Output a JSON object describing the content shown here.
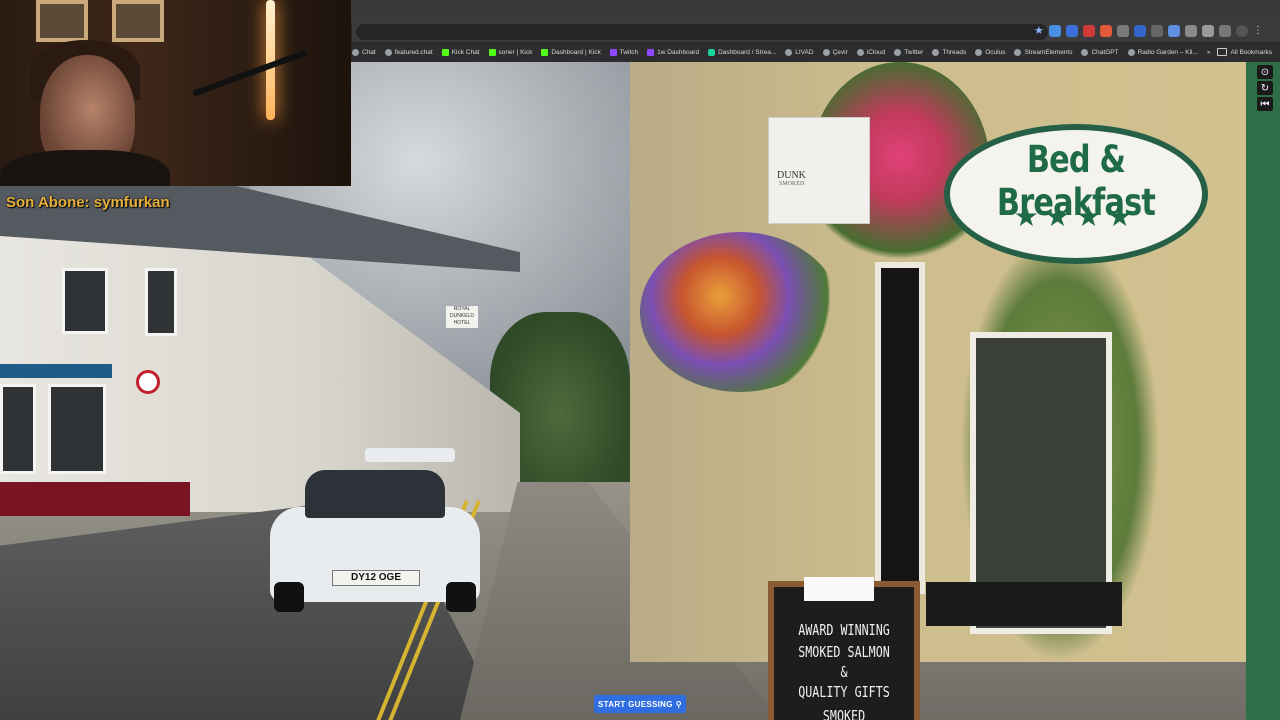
{
  "browser": {
    "bookmarks": [
      {
        "label": "Chat",
        "icon": "globe-icon"
      },
      {
        "label": "featured.chat",
        "icon": "globe-icon"
      },
      {
        "label": "Kick Chat",
        "icon": "kick-icon"
      },
      {
        "label": "soner | Kick",
        "icon": "kick-icon"
      },
      {
        "label": "Dashboard | Kick",
        "icon": "kick-icon"
      },
      {
        "label": "Twitch",
        "icon": "twitch-icon"
      },
      {
        "label": "1w Dashboard",
        "icon": "twitch-icon"
      },
      {
        "label": "Dashboard / Strea...",
        "icon": "streamlabs-icon"
      },
      {
        "label": "LIVAD",
        "icon": "globe-icon"
      },
      {
        "label": "Çevir",
        "icon": "globe-icon"
      },
      {
        "label": "iCloud",
        "icon": "globe-icon"
      },
      {
        "label": "Twitter",
        "icon": "globe-icon"
      },
      {
        "label": "Threads",
        "icon": "globe-icon"
      },
      {
        "label": "Oculus",
        "icon": "globe-icon"
      },
      {
        "label": "StreamElements",
        "icon": "globe-icon"
      },
      {
        "label": "ChatGPT",
        "icon": "globe-icon"
      },
      {
        "label": "Radio Garden – Kli...",
        "icon": "globe-icon"
      }
    ],
    "overflow_label": "»",
    "all_bookmarks_label": "All Bookmarks"
  },
  "overlay": {
    "sub_alert": "Son Abone: symfurkan"
  },
  "scene": {
    "bb_sign": "Bed & Breakfast",
    "bb_stars": "★★★★",
    "smoked_sign": "DUNK",
    "smoked_sign_sub": "SMOKED",
    "plate": "DY12 OGE",
    "hotel_sign": "ROYAL DUNKELD HOTEL",
    "chalkboard_lines": [
      "AWARD WINNING",
      "SMOKED SALMON",
      "&",
      "QUALITY GIFTS",
      "SMOKED"
    ]
  },
  "controls": {
    "start_button": "START GUESSING",
    "start_icon": "map-pin-icon"
  },
  "colors": {
    "accent": "#2f6de0",
    "sub_alert": "#e8b23a",
    "bb_green": "#1f6b48"
  }
}
